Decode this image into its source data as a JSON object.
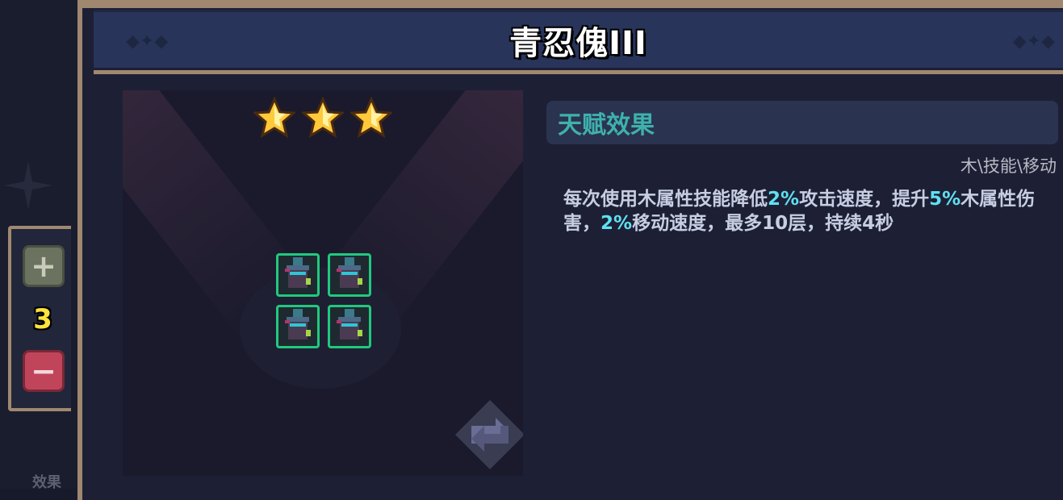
{
  "title": "青忍傀III",
  "stars": 3,
  "unit_count": "3",
  "stepper": {
    "plus_label": "+",
    "minus_label": "−"
  },
  "left_cut_label": "效果",
  "talent": {
    "header": "天赋效果",
    "tags": "木\\技能\\移动",
    "desc_parts": [
      "每次使用木属性技能降低",
      "2%",
      "攻击速度，提升",
      "5%",
      "木属性伤害，",
      "2%",
      "移动速度，最多10层，持续4秒"
    ]
  },
  "colors": {
    "frame": "#a08870",
    "title_bar": "#28345a",
    "highlight": "#5fe0f2",
    "talent_title": "#3fb1ad",
    "unit_border": "#20c97e",
    "minus_button": "#c0455a",
    "plus_button": "#6b7360"
  },
  "icons": {
    "star": "star-icon",
    "refresh": "refresh-icon",
    "unit": "ninja-puppet-icon"
  }
}
